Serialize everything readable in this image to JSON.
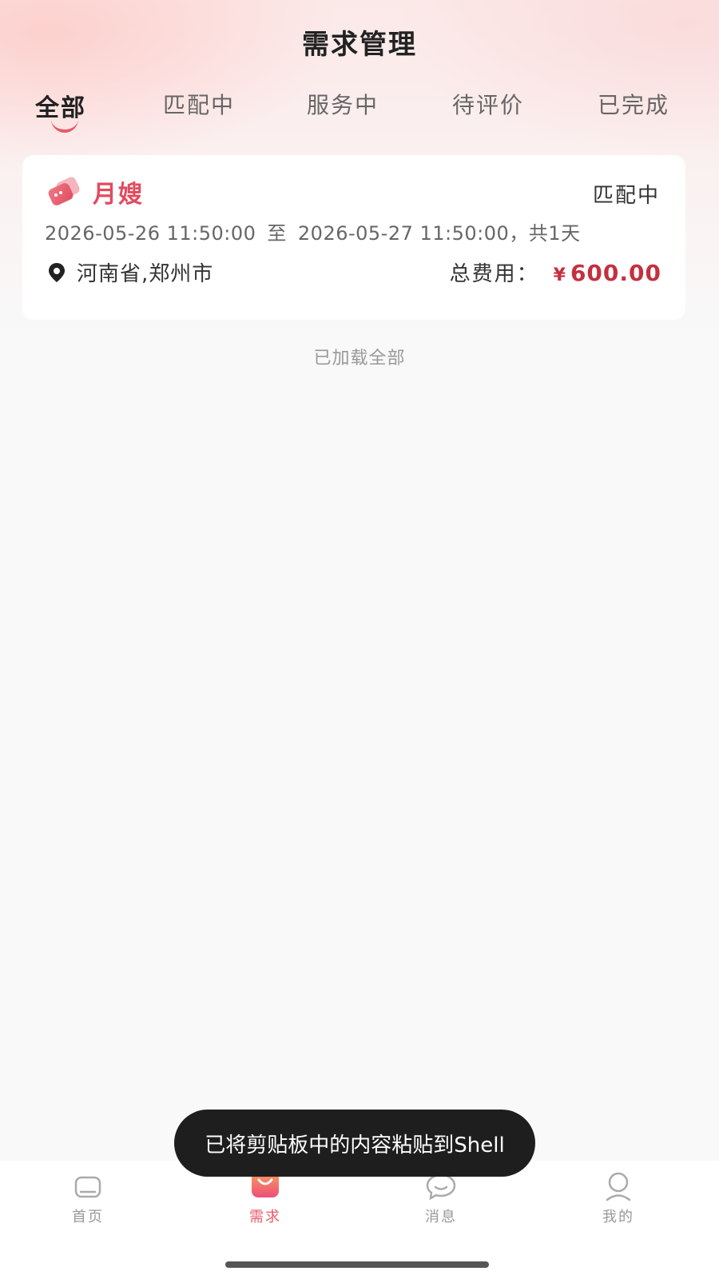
{
  "header": {
    "title": "需求管理"
  },
  "tabs": [
    {
      "label": "全部",
      "active": true
    },
    {
      "label": "匹配中",
      "active": false
    },
    {
      "label": "服务中",
      "active": false
    },
    {
      "label": "待评价",
      "active": false
    },
    {
      "label": "已完成",
      "active": false
    }
  ],
  "orders": [
    {
      "service": "月嫂",
      "service_icon": "tag-icon",
      "status": "匹配中",
      "start": "2026-05-26 11:50:00",
      "to": "至",
      "end": "2026-05-27 11:50:00，共1天",
      "location_icon": "location-pin-icon",
      "location": "河南省,郑州市",
      "fee_label": "总费用：",
      "currency": "¥",
      "amount": "600.00"
    }
  ],
  "list_footer": "已加载全部",
  "toast": "已将剪贴板中的内容粘贴到Shell",
  "bottom_nav": [
    {
      "label": "首页",
      "icon": "home-icon",
      "active": false
    },
    {
      "label": "需求",
      "icon": "bag-icon",
      "active": true
    },
    {
      "label": "消息",
      "icon": "chat-icon",
      "active": false
    },
    {
      "label": "我的",
      "icon": "user-icon",
      "active": false
    }
  ],
  "colors": {
    "accent": "#e8596a",
    "price": "#c4303f",
    "service_name": "#e14b5f"
  }
}
